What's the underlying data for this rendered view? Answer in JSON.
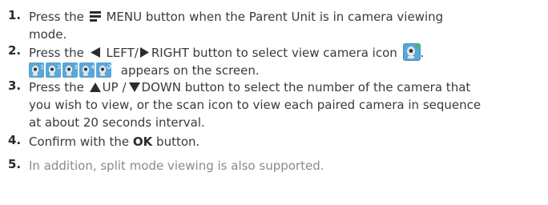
{
  "steps": [
    {
      "num": "1.",
      "a": "Press the",
      "b": "MENU button when the Parent Unit is in camera viewing",
      "c": "mode."
    },
    {
      "num": "2.",
      "a": "Press the",
      "b": "LEFT/",
      "c": "RIGHT button to select view camera icon",
      "d": ".",
      "e": "appears on the screen."
    },
    {
      "num": "3.",
      "a": "Press the",
      "b": "UP /",
      "c": "DOWN button to select the number of the camera that",
      "d": "you wish to view, or the scan icon to view each paired camera in sequence",
      "e": "at about 20 seconds interval."
    },
    {
      "num": "4.",
      "a": "Confirm with the",
      "b": "OK",
      "c": "button."
    },
    {
      "num": "5.",
      "a": "In addition, split mode viewing is also supported."
    }
  ],
  "camera_icons": [
    "1",
    "2",
    "3",
    "4",
    "scan"
  ],
  "icons": {
    "menu": "menu-icon",
    "left": "left-triangle-icon",
    "right": "right-triangle-icon",
    "up": "up-triangle-icon",
    "down": "down-triangle-icon",
    "camera": "view-camera-icon"
  },
  "colors": {
    "icon_blue": "#3f8fc4",
    "icon_blue_light": "#6fb3e0",
    "dot_green": "#2ecc40",
    "text": "#3a3a3a",
    "muted": "#8a8a8a"
  }
}
